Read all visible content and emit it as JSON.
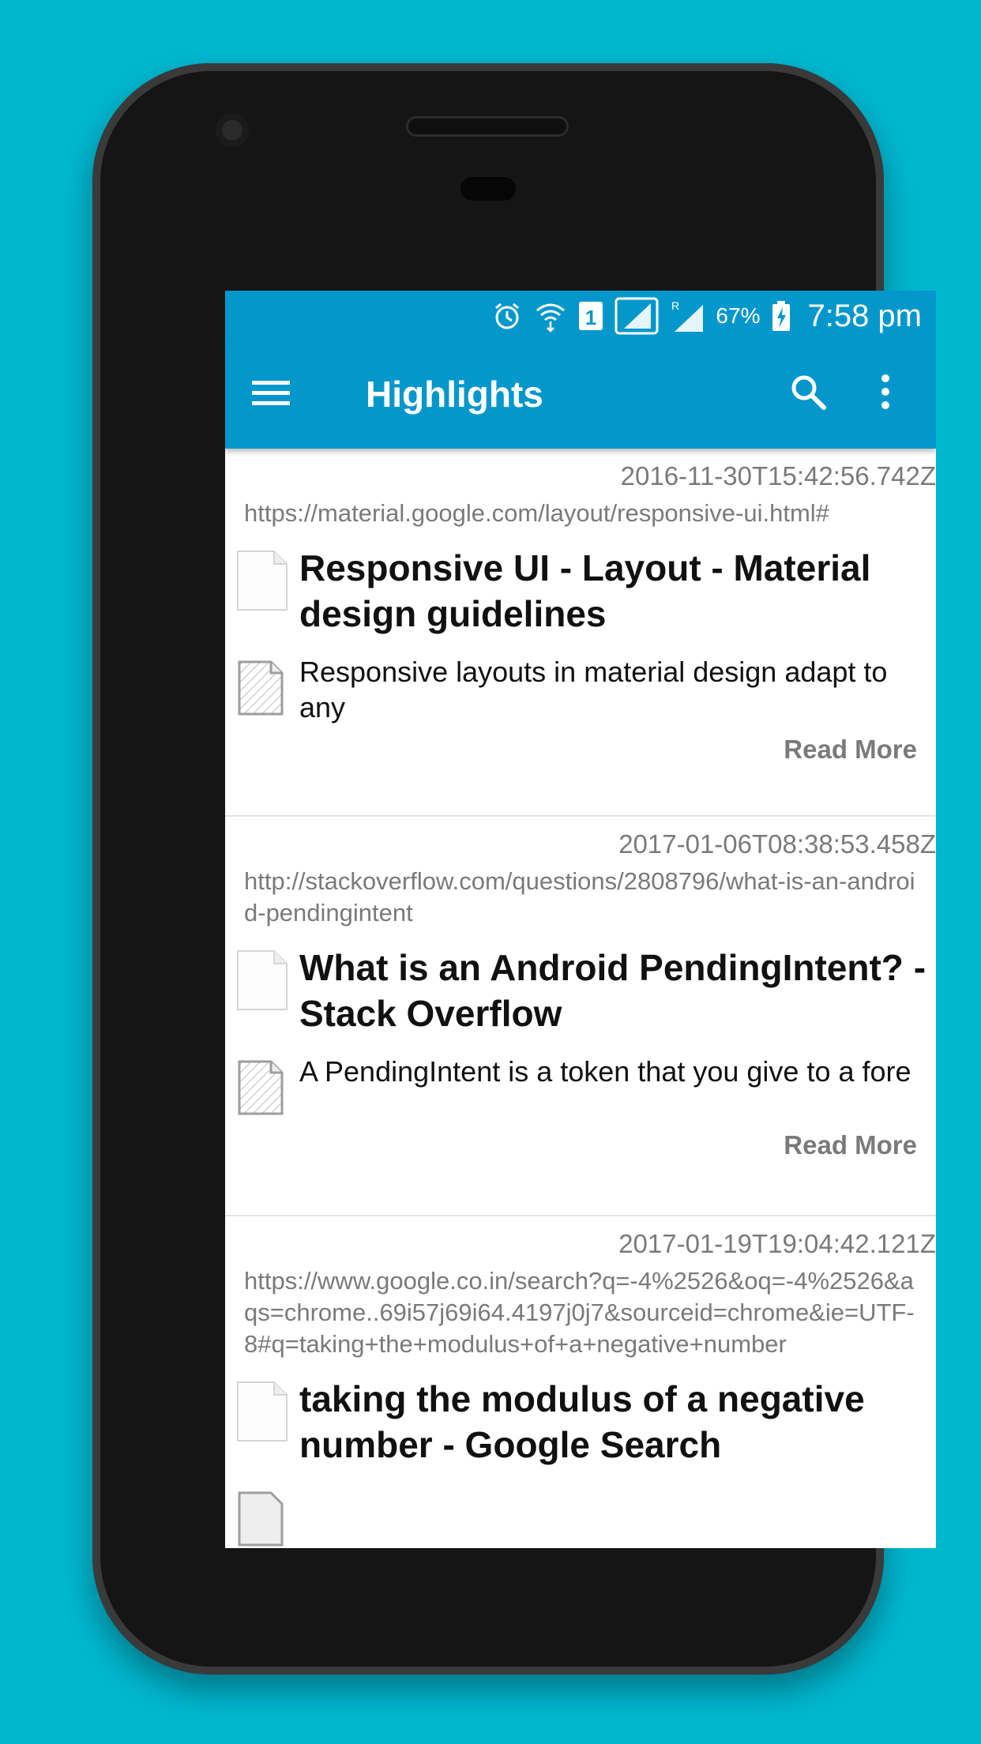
{
  "status_bar": {
    "battery_percent": "67%",
    "time": "7:58 pm",
    "icons": [
      "alarm-icon",
      "wifi-icon",
      "sim1-icon",
      "signal-icon",
      "roaming-signal-icon",
      "battery-charging-icon"
    ],
    "sim_label": "1",
    "roaming_label": "R"
  },
  "app_bar": {
    "title": "Highlights",
    "icons": [
      "menu-icon",
      "search-icon",
      "more-vert-icon"
    ]
  },
  "items": [
    {
      "timestamp": "2016-11-30T15:42:56.742Z",
      "url": "https://material.google.com/layout/responsive-ui.html#",
      "title": "Responsive UI - Layout - Material design guidelines",
      "description": "Responsive layouts in material design adapt to any",
      "read_more": "Read More"
    },
    {
      "timestamp": "2017-01-06T08:38:53.458Z",
      "url": "http://stackoverflow.com/questions/2808796/what-is-an-android-pendingintent",
      "title": "What is an Android PendingIntent? - Stack Overflow",
      "description": "A PendingIntent is a token that you give to a fore",
      "read_more": "Read More"
    },
    {
      "timestamp": "2017-01-19T19:04:42.121Z",
      "url": "https://www.google.co.in/search?q=-4%2526&oq=-4%2526&aqs=chrome..69i57j69i64.4197j0j7&sourceid=chrome&ie=UTF-8#q=taking+the+modulus+of+a+negative+number",
      "title": "taking the modulus of a negative number - Google Search"
    }
  ],
  "colors": {
    "background": "#00b7cf",
    "app_bar": "#0497cc",
    "muted_text": "#7a7a7a"
  }
}
